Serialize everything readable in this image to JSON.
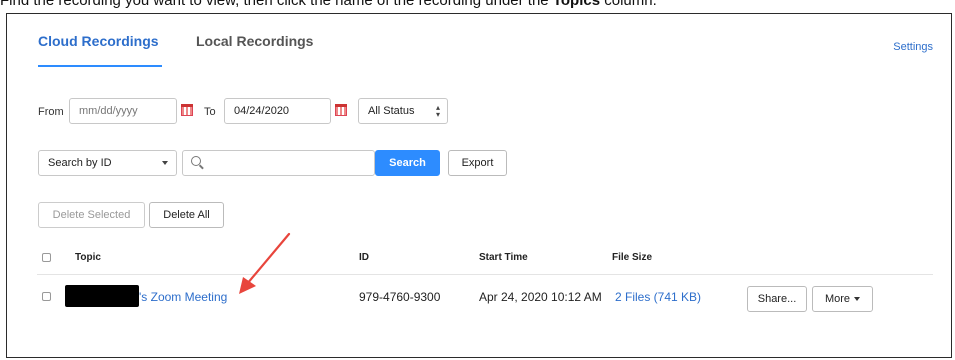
{
  "caption": {
    "prefix": "Find the recording you want to view, then click the name of the recording under the ",
    "bold": "Topics",
    "suffix": " column."
  },
  "tabs": [
    {
      "label": "Cloud Recordings",
      "active": true
    },
    {
      "label": "Local Recordings",
      "active": false
    }
  ],
  "settings_label": "Settings",
  "filters": {
    "from_label": "From",
    "from_placeholder": "mm/dd/yyyy",
    "to_label": "To",
    "to_value": "04/24/2020",
    "status_value": "All Status"
  },
  "search": {
    "by_value": "Search by ID",
    "query_value": "",
    "search_label": "Search",
    "export_label": "Export"
  },
  "actions": {
    "delete_selected": "Delete Selected",
    "delete_all": "Delete All"
  },
  "table": {
    "headers": {
      "topic": "Topic",
      "id": "ID",
      "start_time": "Start Time",
      "file_size": "File Size"
    },
    "rows": [
      {
        "topic": "'s Zoom Meeting",
        "id": "979-4760-9300",
        "start_time": "Apr 24, 2020 10:12 AM",
        "file_size": "2 Files (741 KB)",
        "share_label": "Share...",
        "more_label": "More"
      }
    ]
  },
  "colors": {
    "accent": "#2d8cff",
    "link": "#2d6ecb",
    "annotation_arrow": "#e8453c"
  }
}
